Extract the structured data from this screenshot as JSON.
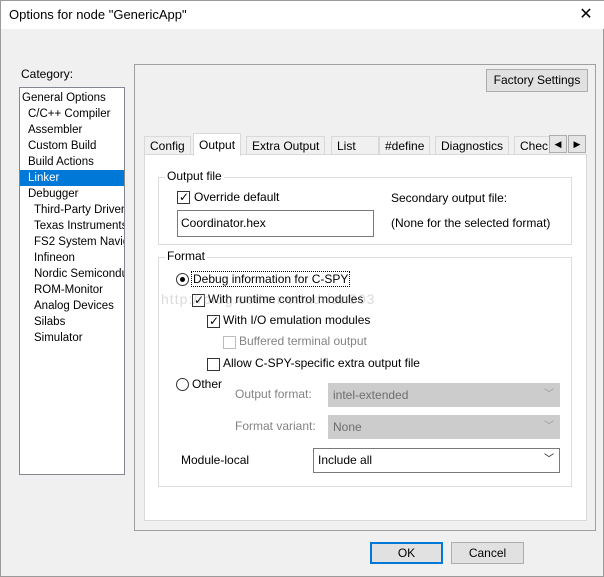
{
  "window": {
    "title": "Options for node \"GenericApp\"",
    "close": "✕"
  },
  "category": {
    "label": "Category:",
    "items": [
      {
        "label": "General Options"
      },
      {
        "label": "C/C++ Compiler"
      },
      {
        "label": "Assembler"
      },
      {
        "label": "Custom Build"
      },
      {
        "label": "Build Actions"
      },
      {
        "label": "Linker"
      },
      {
        "label": "Debugger"
      },
      {
        "label": "Third-Party Driver"
      },
      {
        "label": "Texas Instruments"
      },
      {
        "label": "FS2 System Naviga"
      },
      {
        "label": "Infineon"
      },
      {
        "label": "Nordic Semiconduc"
      },
      {
        "label": "ROM-Monitor"
      },
      {
        "label": "Analog Devices"
      },
      {
        "label": "Silabs"
      },
      {
        "label": "Simulator"
      }
    ],
    "selected": "Linker"
  },
  "factory_settings": "Factory Settings",
  "tabs": [
    {
      "label": "Config"
    },
    {
      "label": "Output"
    },
    {
      "label": "Extra Output"
    },
    {
      "label": "List"
    },
    {
      "label": "#define"
    },
    {
      "label": "Diagnostics"
    },
    {
      "label": "Chec"
    }
  ],
  "tab_scroll": {
    "left": "◀",
    "right": "▶"
  },
  "output_file": {
    "group_label": "Output file",
    "override_label": "Override default",
    "override_checked": true,
    "filename": "Coordinator.hex",
    "secondary_label": "Secondary output file:",
    "secondary_value": "(None for the selected format)"
  },
  "format": {
    "group_label": "Format",
    "debug_info": "Debug information for C-SPY",
    "runtime_control": "With runtime control modules",
    "io_emulation": "With I/O emulation modules",
    "buffered_terminal": "Buffered terminal output",
    "allow_extra": "Allow C-SPY-specific extra output file",
    "other": "Other",
    "output_format_label": "Output format:",
    "output_format_value": "intel-extended",
    "format_variant_label": "Format variant:",
    "format_variant_value": "None",
    "module_local_label": "Module-local",
    "module_local_value": "Include all"
  },
  "buttons": {
    "ok": "OK",
    "cancel": "Cancel"
  },
  "watermark": "http://blog.csdn.net/adrian503"
}
